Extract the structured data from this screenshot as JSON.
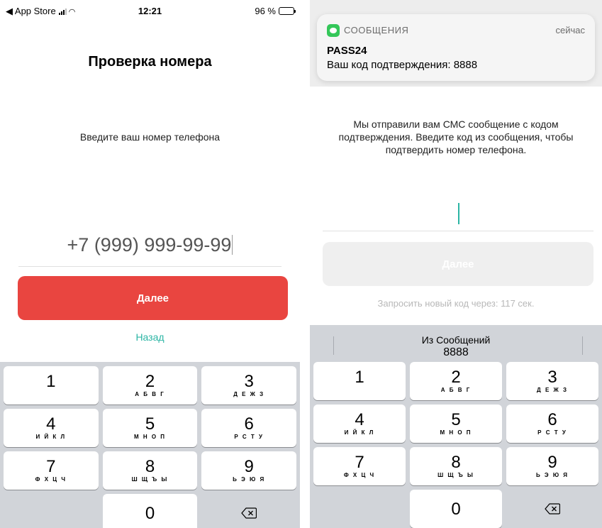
{
  "left": {
    "status": {
      "back": "◀ App Store",
      "time": "12:21",
      "battery": "96 %"
    },
    "title": "Проверка номера",
    "subtitle": "Введите ваш номер телефона",
    "phone_placeholder": "+7 (999) 999-99-99",
    "next_button": "Далее",
    "back_link": "Назад"
  },
  "right": {
    "notification": {
      "app": "СООБЩЕНИЯ",
      "time": "сейчас",
      "sender": "PASS24",
      "body": "Ваш код подтверждения: 8888"
    },
    "info": "Мы отправили вам СМС сообщение с кодом подтверждения. Введите код из сообщения, чтобы подтвердить номер телефона.",
    "next_button": "Далее",
    "resend": "Запросить новый код через: 117 сек.",
    "suggestion": {
      "source": "Из Сообщений",
      "code": "8888"
    }
  },
  "keyboard": {
    "keys": [
      {
        "num": "1",
        "letters": ""
      },
      {
        "num": "2",
        "letters": "А Б В Г"
      },
      {
        "num": "3",
        "letters": "Д Е Ж З"
      },
      {
        "num": "4",
        "letters": "И Й К Л"
      },
      {
        "num": "5",
        "letters": "М Н О П"
      },
      {
        "num": "6",
        "letters": "Р С Т У"
      },
      {
        "num": "7",
        "letters": "Ф Х Ц Ч"
      },
      {
        "num": "8",
        "letters": "Ш Щ Ъ Ы"
      },
      {
        "num": "9",
        "letters": "Ь Э Ю Я"
      },
      {
        "num": "0",
        "letters": ""
      }
    ],
    "delete_icon": "backspace-icon"
  },
  "colors": {
    "primary": "#e94540",
    "accent": "#2bb5a4",
    "disabled": "#efefef",
    "keyboard_bg": "#d1d4d9",
    "messages_green": "#34c759"
  }
}
